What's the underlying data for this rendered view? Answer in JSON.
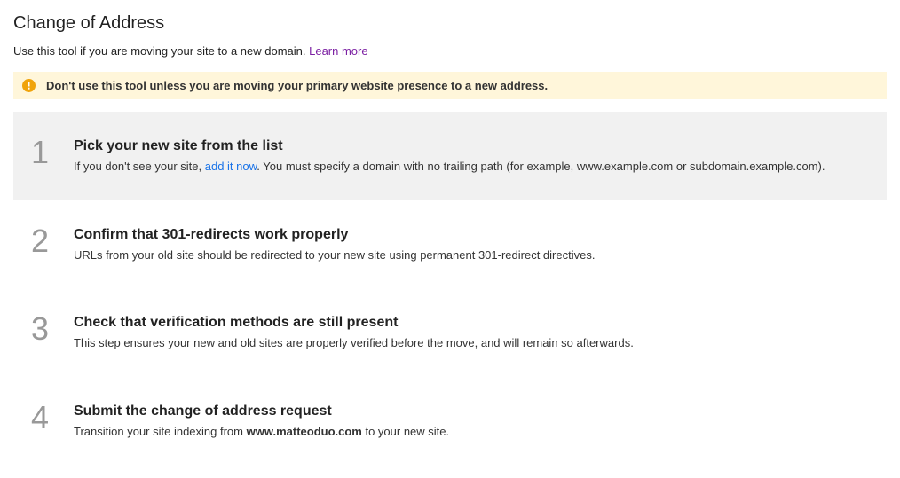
{
  "title": "Change of Address",
  "intro_before": "Use this tool if you are moving your site to a new domain. ",
  "intro_learn_more": "Learn more",
  "warning_text": "Don't use this tool unless you are moving your primary website presence to a new address.",
  "steps": [
    {
      "number": "1",
      "title": "Pick your new site from the list",
      "desc_before": "If you don't see your site, ",
      "desc_link": "add it now",
      "desc_after": ". You must specify a domain with no trailing path (for example, www.example.com or subdomain.example.com)."
    },
    {
      "number": "2",
      "title": "Confirm that 301-redirects work properly",
      "desc": "URLs from your old site should be redirected to your new site using permanent 301-redirect directives."
    },
    {
      "number": "3",
      "title": "Check that verification methods are still present",
      "desc": "This step ensures your new and old sites are properly verified before the move, and will remain so afterwards."
    },
    {
      "number": "4",
      "title": "Submit the change of address request",
      "desc_before": "Transition your site indexing from ",
      "desc_domain": "www.matteoduo.com",
      "desc_after": " to your new site."
    }
  ]
}
